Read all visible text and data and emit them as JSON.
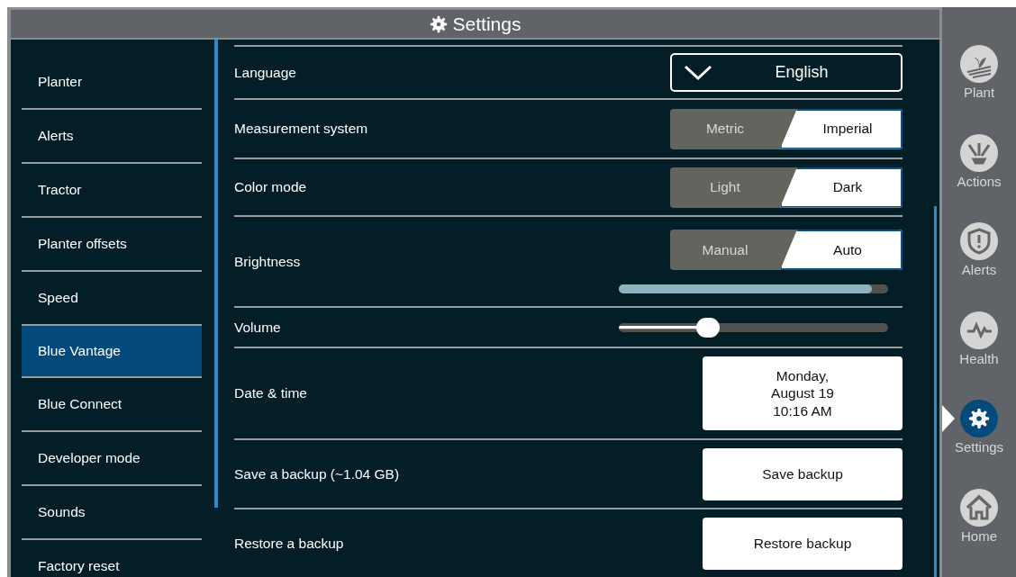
{
  "header": {
    "title": "Settings"
  },
  "sidebar": {
    "items": [
      {
        "label": "Planter",
        "selected": false
      },
      {
        "label": "Alerts",
        "selected": false
      },
      {
        "label": "Tractor",
        "selected": false
      },
      {
        "label": "Planter offsets",
        "selected": false
      },
      {
        "label": "Speed",
        "selected": false
      },
      {
        "label": "Blue Vantage",
        "selected": true
      },
      {
        "label": "Blue Connect",
        "selected": false
      },
      {
        "label": "Developer mode",
        "selected": false
      },
      {
        "label": "Sounds",
        "selected": false
      },
      {
        "label": "Factory reset",
        "selected": false
      }
    ]
  },
  "settings": [
    {
      "kind": "dropdown",
      "label": "Language",
      "value": "English"
    },
    {
      "kind": "toggle",
      "label": "Measurement system",
      "options": [
        {
          "label": "Metric",
          "selected": false
        },
        {
          "label": "Imperial",
          "selected": true
        }
      ]
    },
    {
      "kind": "toggle",
      "label": "Color mode",
      "options": [
        {
          "label": "Light",
          "selected": false
        },
        {
          "label": "Dark",
          "selected": true
        }
      ]
    },
    {
      "kind": "toggle",
      "label": "Brightness",
      "options": [
        {
          "label": "Manual",
          "selected": false
        },
        {
          "label": "Auto",
          "selected": true
        }
      ],
      "level": 0.94
    },
    {
      "kind": "slider",
      "label": "Volume",
      "level": 0.33
    },
    {
      "kind": "button",
      "label": "Date & time",
      "button": "Monday,\nAugust 19\n10:16 AM"
    },
    {
      "kind": "button",
      "label": "Save a backup (~1.04 GB)",
      "button": "Save backup"
    },
    {
      "kind": "button",
      "label": "Restore a backup",
      "button": "Restore backup"
    }
  ],
  "rail": [
    {
      "kind": "plant",
      "label": "Plant",
      "selected": false
    },
    {
      "kind": "actions",
      "label": "Actions",
      "selected": false
    },
    {
      "kind": "alerts",
      "label": "Alerts",
      "selected": false
    },
    {
      "kind": "health",
      "label": "Health",
      "selected": false
    },
    {
      "kind": "settings",
      "label": "Settings",
      "selected": true
    },
    {
      "kind": "home",
      "label": "Home",
      "selected": false
    }
  ]
}
